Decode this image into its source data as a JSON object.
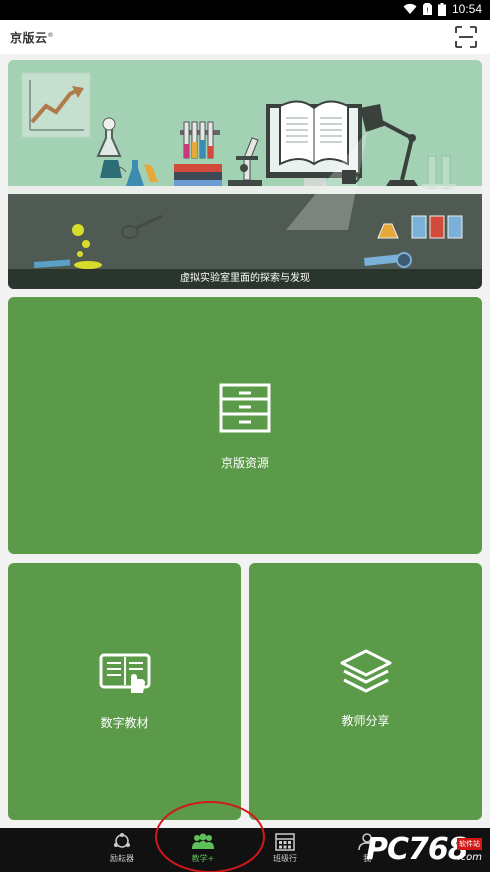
{
  "status_bar": {
    "time": "10:54"
  },
  "header": {
    "logo_text": "京版云",
    "logo_mark": "®"
  },
  "banner": {
    "caption": "虚拟实验室里面的探索与发现"
  },
  "cards": {
    "resources": {
      "label": "京版资源"
    },
    "textbook": {
      "label": "数字教材"
    },
    "teacher_share": {
      "label": "教师分享"
    }
  },
  "nav": {
    "items": [
      {
        "label": "励耘器"
      },
      {
        "label": "教学+"
      },
      {
        "label": "班级行"
      },
      {
        "label": "我"
      }
    ],
    "active_index": 1
  },
  "watermark": {
    "brand": "PC768",
    "badge": "软件站",
    "domain": ".com"
  },
  "colors": {
    "card_green": "#5a9a48",
    "nav_active": "#5fbf5a",
    "annotation_red": "#d11818"
  }
}
